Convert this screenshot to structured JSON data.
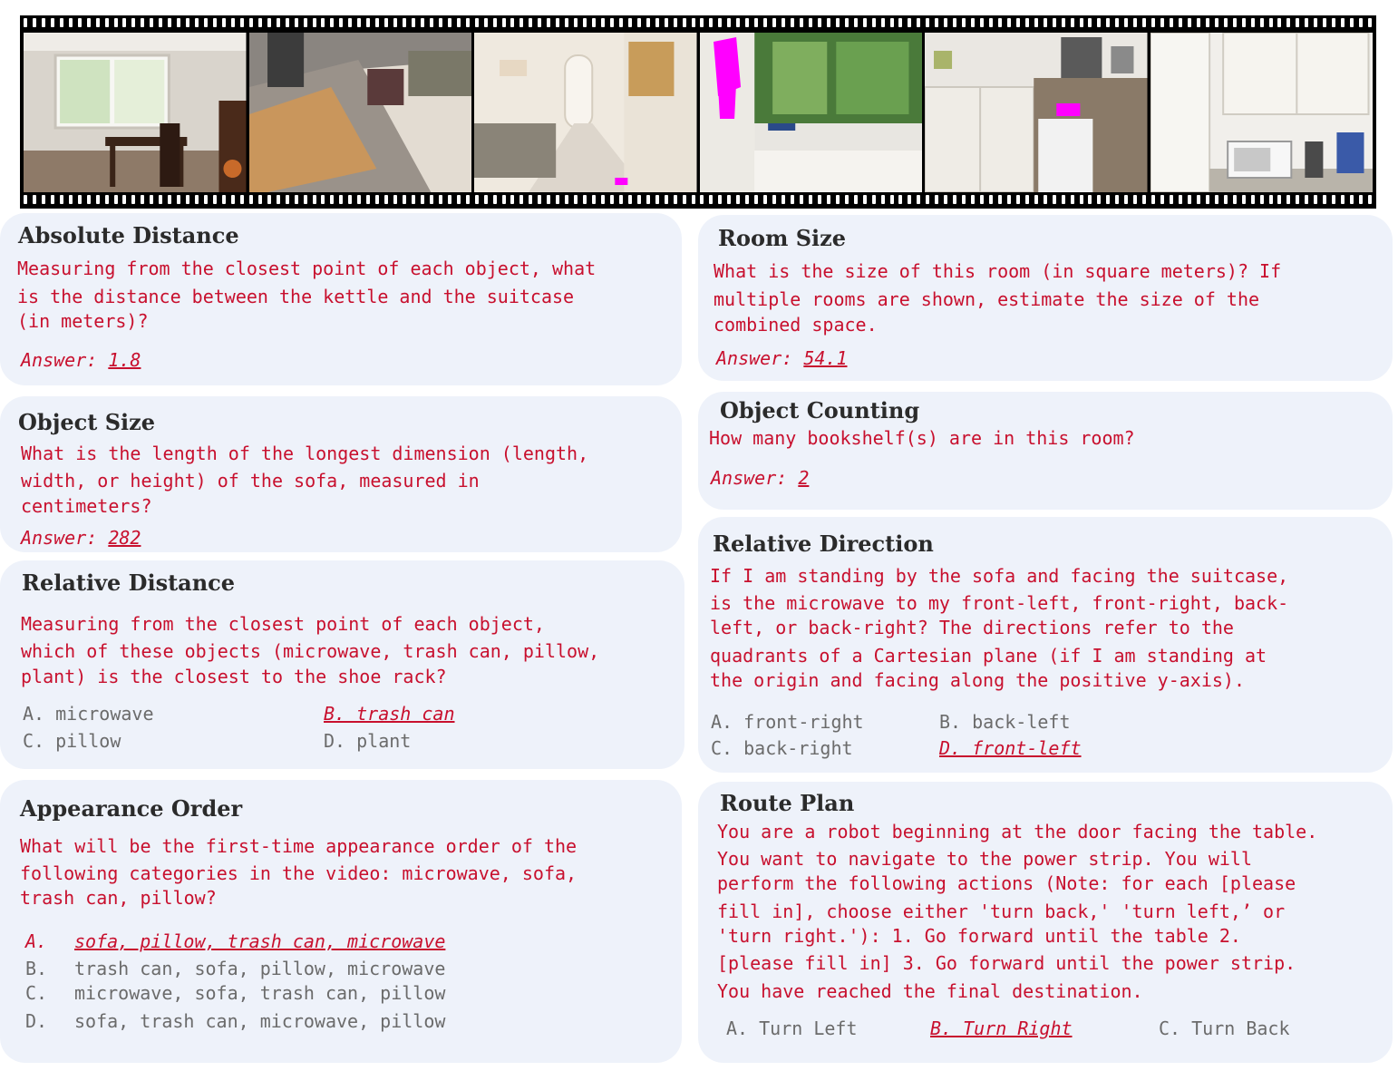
{
  "absolute_distance": {
    "title": "Absolute Distance",
    "question_lines": [
      "Measuring from the closest point of each object, what",
      "is the distance between the kettle and the suitcase",
      "(in meters)?"
    ],
    "answer_prefix": "Answer: ",
    "answer_value": "1.8"
  },
  "object_size": {
    "title": "Object Size",
    "question_lines": [
      "What is the length of the longest dimension (length,",
      "width, or height) of the sofa, measured in",
      "centimeters?"
    ],
    "answer_prefix": "Answer: ",
    "answer_value": "282"
  },
  "relative_distance": {
    "title": "Relative Distance",
    "question_lines": [
      "Measuring from the closest point of each object,",
      "which of these objects (microwave, trash can, pillow,",
      "plant) is the closest to the shoe rack?"
    ],
    "options": [
      "A. microwave",
      "B. trash can",
      "C. pillow",
      "D. plant"
    ],
    "correct_index": 1
  },
  "appearance_order": {
    "title": "Appearance Order",
    "question_lines": [
      "What will be the first-time appearance order of the",
      "following categories in the video: microwave, sofa,",
      "trash can, pillow?"
    ],
    "option_letters": [
      "A.",
      "B.",
      "C.",
      "D."
    ],
    "option_texts": [
      "sofa, pillow, trash can, microwave",
      "trash can, sofa, pillow, microwave",
      "microwave, sofa, trash can, pillow",
      "sofa, trash can, microwave, pillow"
    ],
    "correct_index": 0
  },
  "room_size": {
    "title": "Room Size",
    "question_lines": [
      "What is the size of this room (in square meters)? If",
      "multiple rooms are shown, estimate the size of the",
      "combined space."
    ],
    "answer_prefix": "Answer: ",
    "answer_value": "54.1"
  },
  "object_counting": {
    "title": "Object Counting",
    "question_lines": [
      "How many bookshelf(s) are in this room?"
    ],
    "answer_prefix": "Answer: ",
    "answer_value": "2"
  },
  "relative_direction": {
    "title": "Relative Direction",
    "question_lines": [
      "If I am standing by the sofa and facing the suitcase,",
      "is the microwave to my front-left, front-right, back-",
      "left, or back-right? The directions refer to the",
      "quadrants of a Cartesian plane (if I am standing at",
      "the origin and facing along the positive y-axis)."
    ],
    "options": [
      "A. front-right",
      "B. back-left",
      "C. back-right",
      "D. front-left"
    ],
    "correct_index": 3
  },
  "route_plan": {
    "title": "Route Plan",
    "question_lines": [
      "You are a robot beginning at the door facing the table.",
      "You want to navigate to the power strip. You will",
      "perform the following actions (Note: for each [please",
      "fill in], choose either 'turn back,' 'turn left,’ or",
      "'turn right.'): 1. Go forward until the table 2.",
      "[please fill in] 3. Go forward until the power strip.",
      "You have reached the final destination."
    ],
    "options": [
      "A. Turn Left",
      "B. Turn Right",
      "C. Turn Back"
    ],
    "correct_index": 1
  },
  "filmstrip": {
    "frames": [
      "dining-room-frame",
      "table-floor-frame",
      "hallway-frame",
      "kitchen-sink-frame",
      "kitchen-cabinet-frame",
      "kitchen-microwave-frame"
    ],
    "highlight_color": "#ff00ff"
  },
  "colors": {
    "question_text": "#c8102e",
    "option_text": "#6b6b6b",
    "card_background": "#eef2fa"
  }
}
